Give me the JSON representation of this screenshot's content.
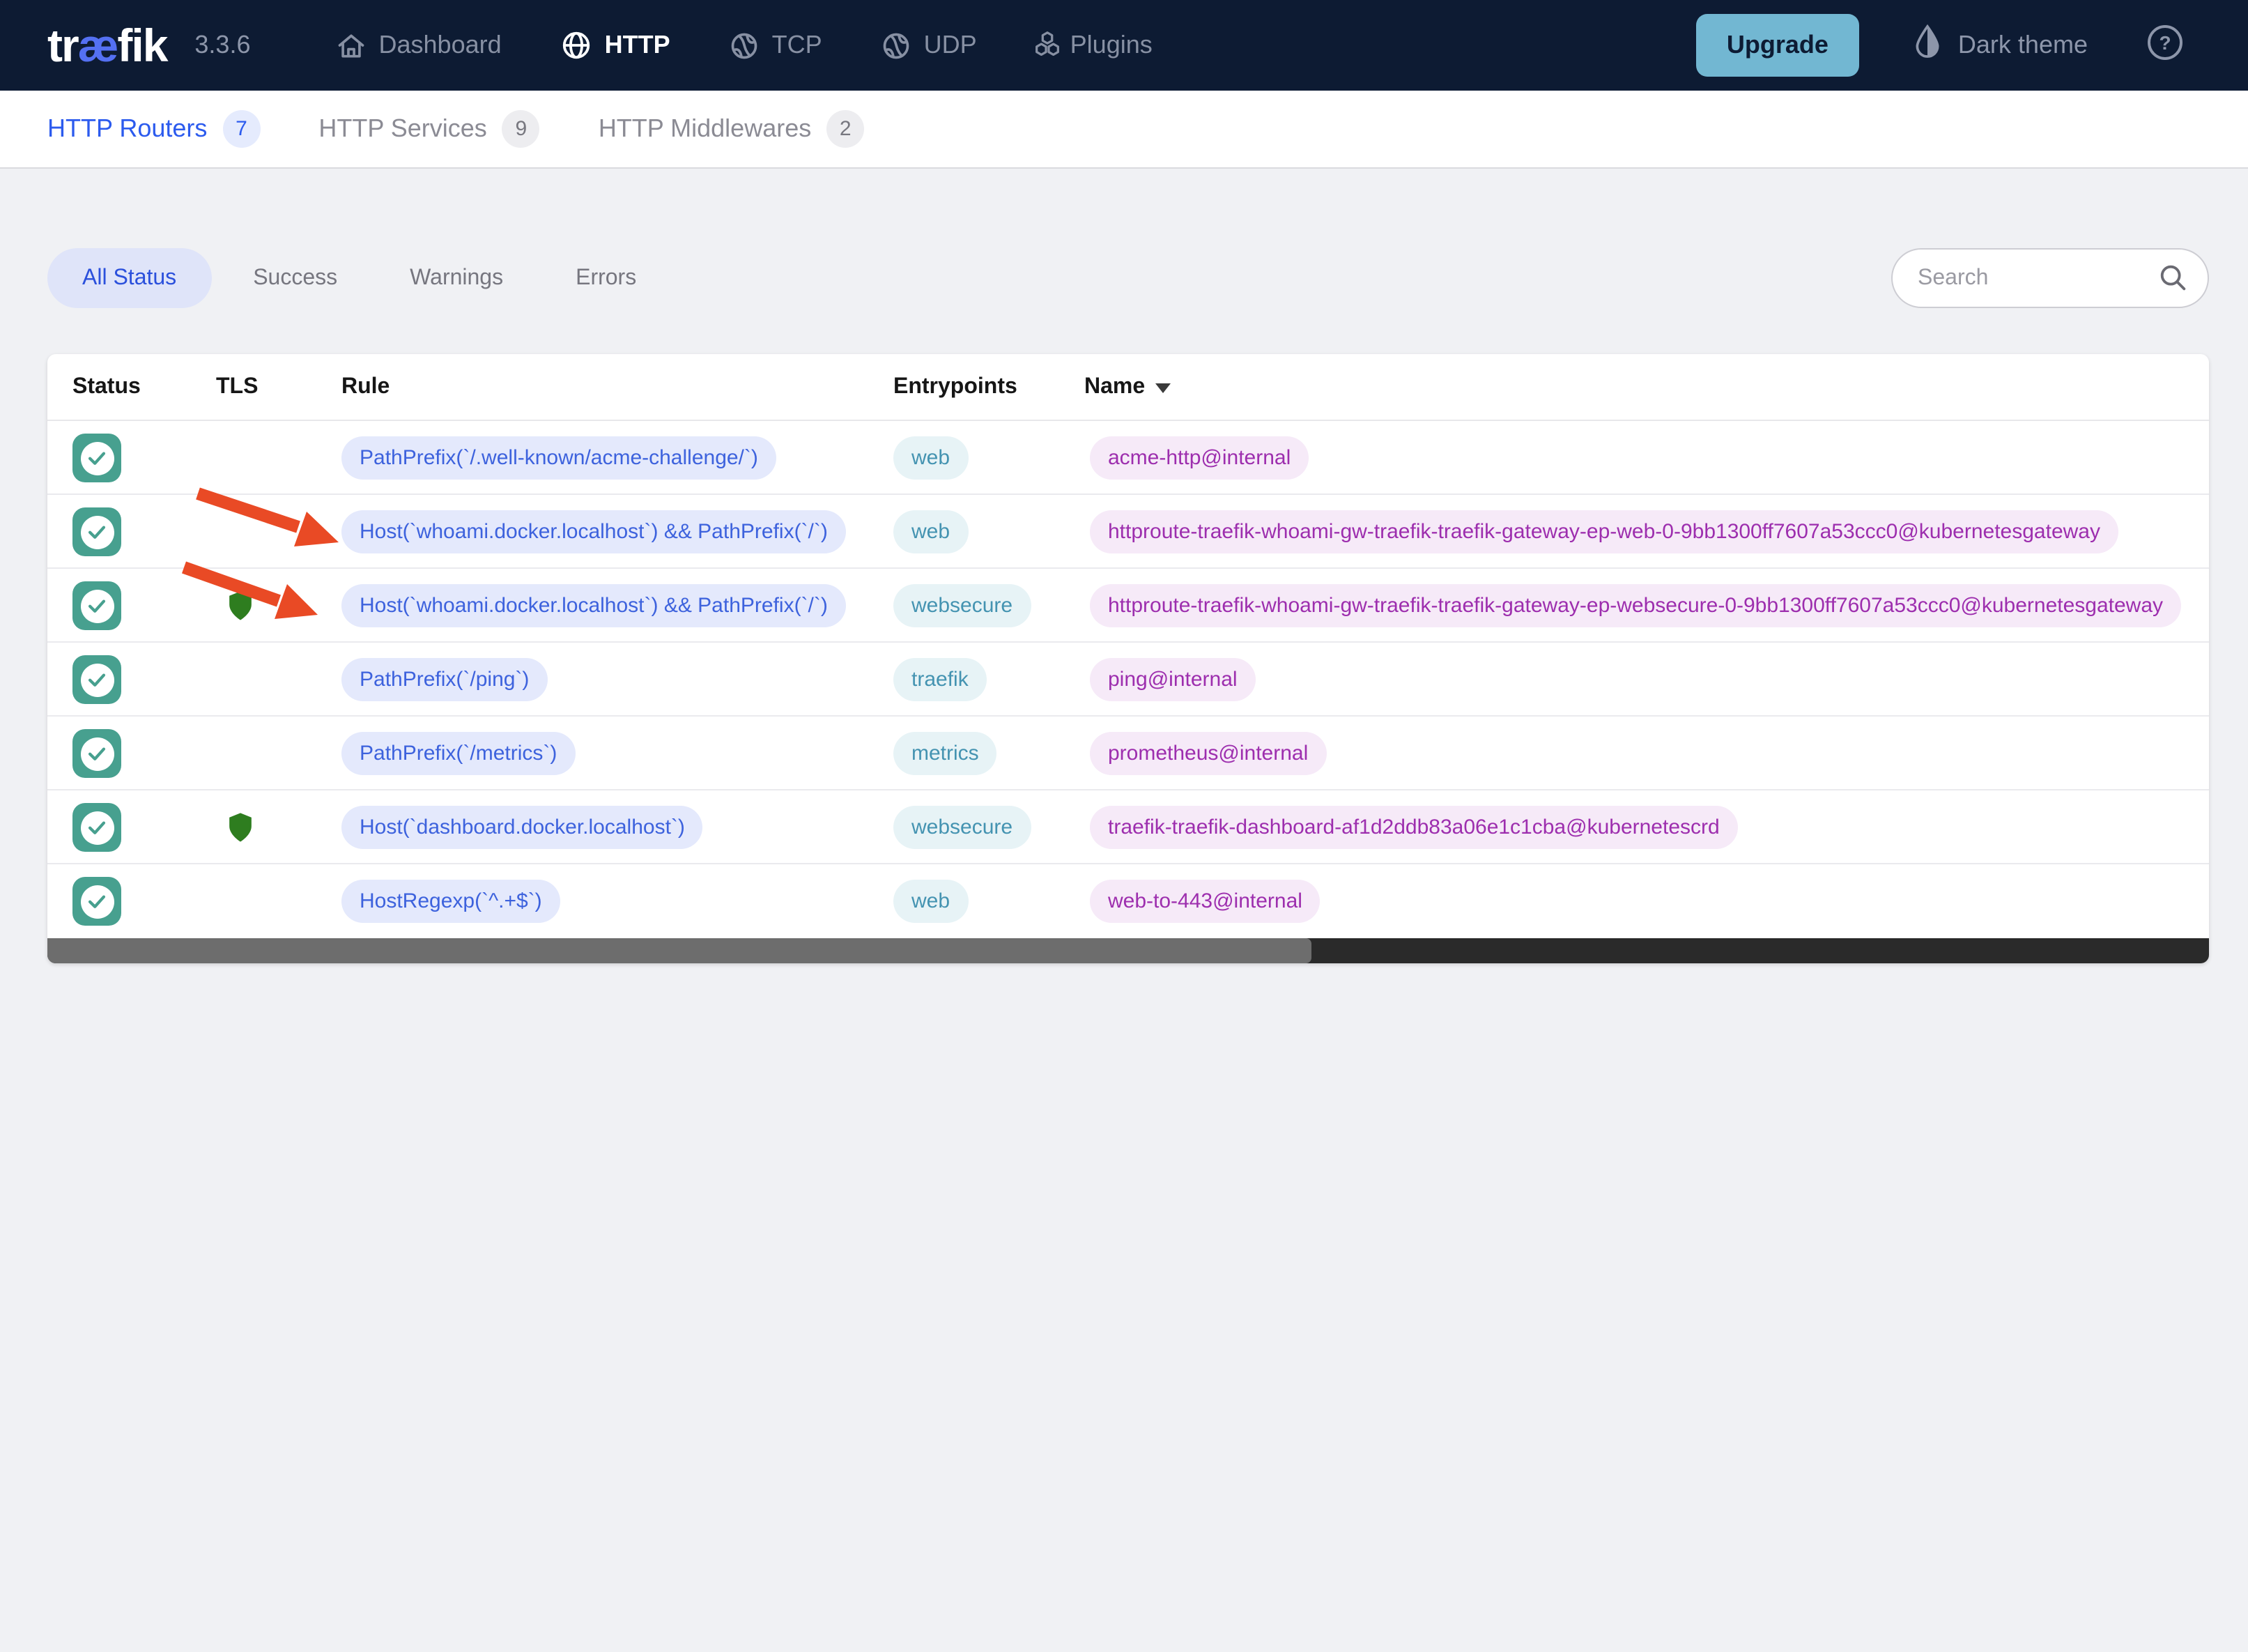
{
  "navbar": {
    "logo_pre": "tr",
    "logo_ae": "æ",
    "logo_post": "fik",
    "version": "3.3.6",
    "items": [
      {
        "label": "Dashboard"
      },
      {
        "label": "HTTP"
      },
      {
        "label": "TCP"
      },
      {
        "label": "UDP"
      },
      {
        "label": "Plugins"
      }
    ],
    "upgrade_label": "Upgrade",
    "theme_label": "Dark theme",
    "help_glyph": "?"
  },
  "tabs": [
    {
      "label": "HTTP Routers",
      "count": "7"
    },
    {
      "label": "HTTP Services",
      "count": "9"
    },
    {
      "label": "HTTP Middlewares",
      "count": "2"
    }
  ],
  "filters": [
    "All Status",
    "Success",
    "Warnings",
    "Errors"
  ],
  "search": {
    "placeholder": "Search"
  },
  "table": {
    "headers": {
      "status": "Status",
      "tls": "TLS",
      "rule": "Rule",
      "entrypoints": "Entrypoints",
      "name": "Name"
    },
    "rows": [
      {
        "status": "enabled",
        "tls": false,
        "rule": "PathPrefix(`/.well-known/acme-challenge/`)",
        "entrypoint": "web",
        "name": "acme-http@internal"
      },
      {
        "status": "enabled",
        "tls": false,
        "rule": "Host(`whoami.docker.localhost`) && PathPrefix(`/`)",
        "entrypoint": "web",
        "name": "httproute-traefik-whoami-gw-traefik-traefik-gateway-ep-web-0-9bb1300ff7607a53ccc0@kubernetesgateway"
      },
      {
        "status": "enabled",
        "tls": true,
        "rule": "Host(`whoami.docker.localhost`) && PathPrefix(`/`)",
        "entrypoint": "websecure",
        "name": "httproute-traefik-whoami-gw-traefik-traefik-gateway-ep-websecure-0-9bb1300ff7607a53ccc0@kubernetesgateway"
      },
      {
        "status": "enabled",
        "tls": false,
        "rule": "PathPrefix(`/ping`)",
        "entrypoint": "traefik",
        "name": "ping@internal"
      },
      {
        "status": "enabled",
        "tls": false,
        "rule": "PathPrefix(`/metrics`)",
        "entrypoint": "metrics",
        "name": "prometheus@internal"
      },
      {
        "status": "enabled",
        "tls": true,
        "rule": "Host(`dashboard.docker.localhost`)",
        "entrypoint": "websecure",
        "name": "traefik-traefik-dashboard-af1d2ddb83a06e1c1cba@kubernetescrd"
      },
      {
        "status": "enabled",
        "tls": false,
        "rule": "HostRegexp(`^.+$`)",
        "entrypoint": "web",
        "name": "web-to-443@internal"
      }
    ]
  },
  "colors": {
    "navbar_bg": "#0d1b33",
    "logo_accent": "#5470f2",
    "upgrade_bg": "#72b7d2",
    "active_link": "#2c5bee",
    "filter_active": "#2b50dc",
    "status_ok": "#47a08f",
    "rule_text": "#3d62dd",
    "entry_text": "#4493b1",
    "name_text": "#9d2eae",
    "tls_shield": "#2e7d1f",
    "arrow": "#e94a25",
    "page_bg": "#f0f1f4"
  }
}
